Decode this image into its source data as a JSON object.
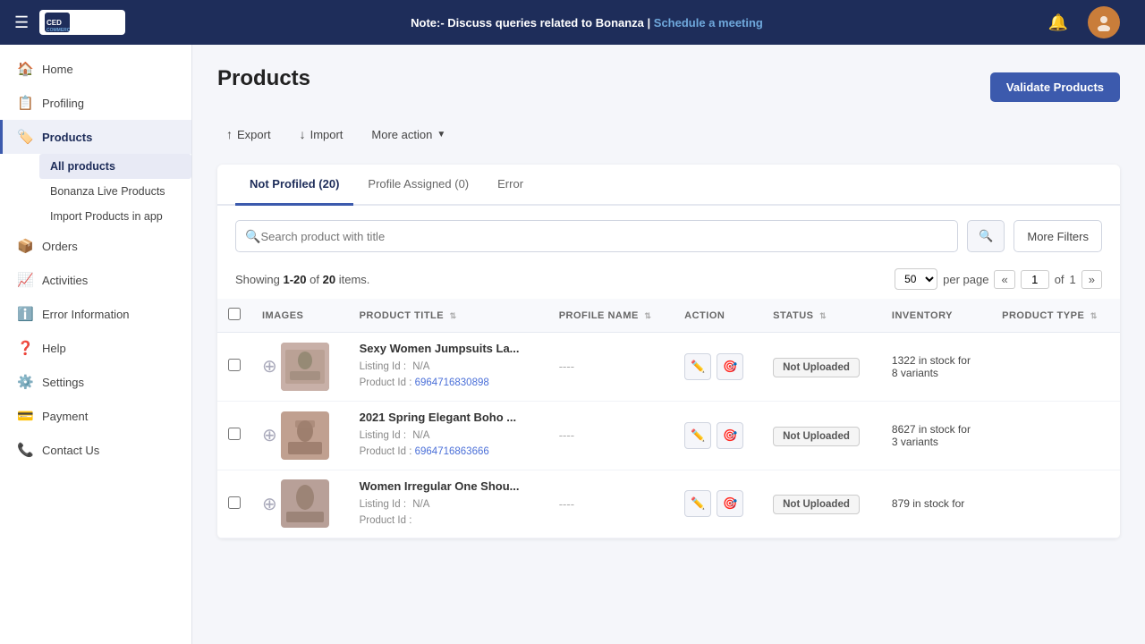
{
  "topnav": {
    "note_prefix": "Note:- Discuss queries related to Bonanza |",
    "note_link": "Schedule a meeting",
    "hamburger": "☰",
    "bell": "🔔",
    "avatar_initials": ""
  },
  "sidebar": {
    "items": [
      {
        "id": "home",
        "icon": "🏠",
        "label": "Home",
        "active": false
      },
      {
        "id": "profiling",
        "icon": "📋",
        "label": "Profiling",
        "active": false
      },
      {
        "id": "products",
        "icon": "🏷️",
        "label": "Products",
        "active": true
      },
      {
        "id": "orders",
        "icon": "📦",
        "label": "Orders",
        "active": false
      },
      {
        "id": "activities",
        "icon": "📈",
        "label": "Activities",
        "active": false
      },
      {
        "id": "error-information",
        "icon": "ℹ️",
        "label": "Error Information",
        "active": false
      },
      {
        "id": "help",
        "icon": "❓",
        "label": "Help",
        "active": false
      },
      {
        "id": "settings",
        "icon": "⚙️",
        "label": "Settings",
        "active": false
      },
      {
        "id": "payment",
        "icon": "💳",
        "label": "Payment",
        "active": false
      },
      {
        "id": "contact-us",
        "icon": "📞",
        "label": "Contact Us",
        "active": false
      }
    ],
    "sub_items": [
      {
        "id": "all-products",
        "label": "All products",
        "active": true
      },
      {
        "id": "bonanza-live-products",
        "label": "Bonanza Live Products",
        "active": false
      },
      {
        "id": "import-products-in-app",
        "label": "Import Products in app",
        "active": false
      }
    ]
  },
  "page": {
    "title": "Products",
    "toolbar": {
      "export_label": "Export",
      "import_label": "Import",
      "more_action_label": "More action",
      "validate_label": "Validate Products"
    },
    "tabs": [
      {
        "id": "not-profiled",
        "label": "Not Profiled (20)",
        "active": true
      },
      {
        "id": "profile-assigned",
        "label": "Profile Assigned (0)",
        "active": false
      },
      {
        "id": "error",
        "label": "Error",
        "active": false
      }
    ],
    "search": {
      "placeholder": "Search product with title"
    },
    "more_filters_label": "More Filters",
    "showing_text": "Showing",
    "showing_range": "1-20",
    "showing_of": "of",
    "showing_total": "20",
    "showing_suffix": "items.",
    "per_page": "50",
    "per_page_label": "per page",
    "page_current": "1",
    "page_of": "of",
    "page_total": "1",
    "table": {
      "columns": [
        {
          "id": "images",
          "label": "IMAGES",
          "sortable": false
        },
        {
          "id": "product-title",
          "label": "PRODUCT TITLE",
          "sortable": true
        },
        {
          "id": "profile-name",
          "label": "PROFILE NAME",
          "sortable": true
        },
        {
          "id": "action",
          "label": "ACTION",
          "sortable": false
        },
        {
          "id": "status",
          "label": "STATUS",
          "sortable": true
        },
        {
          "id": "inventory",
          "label": "INVENTORY",
          "sortable": false
        },
        {
          "id": "product-type",
          "label": "PRODUCT TYPE",
          "sortable": true
        }
      ],
      "rows": [
        {
          "id": "row-1",
          "image_bg": "#c8b0a8",
          "title": "Sexy Women Jumpsuits La...",
          "listing_id_label": "Listing Id :",
          "listing_id_value": "N/A",
          "product_id_label": "Product Id :",
          "product_id_value": "6964716830898",
          "profile_name": "----",
          "status": "Not Uploaded",
          "inventory": "1322 in stock for",
          "inventory2": "8 variants",
          "product_type": ""
        },
        {
          "id": "row-2",
          "image_bg": "#c0a090",
          "title": "2021 Spring Elegant Boho ...",
          "listing_id_label": "Listing Id :",
          "listing_id_value": "N/A",
          "product_id_label": "Product Id :",
          "product_id_value": "6964716863666",
          "profile_name": "----",
          "status": "Not Uploaded",
          "inventory": "8627 in stock for",
          "inventory2": "3 variants",
          "product_type": ""
        },
        {
          "id": "row-3",
          "image_bg": "#b8a098",
          "title": "Women Irregular One Shou...",
          "listing_id_label": "Listing Id :",
          "listing_id_value": "N/A",
          "product_id_label": "Product Id :",
          "product_id_value": "",
          "profile_name": "----",
          "status": "Not Uploaded",
          "inventory": "879 in stock for",
          "inventory2": "",
          "product_type": ""
        }
      ]
    }
  }
}
